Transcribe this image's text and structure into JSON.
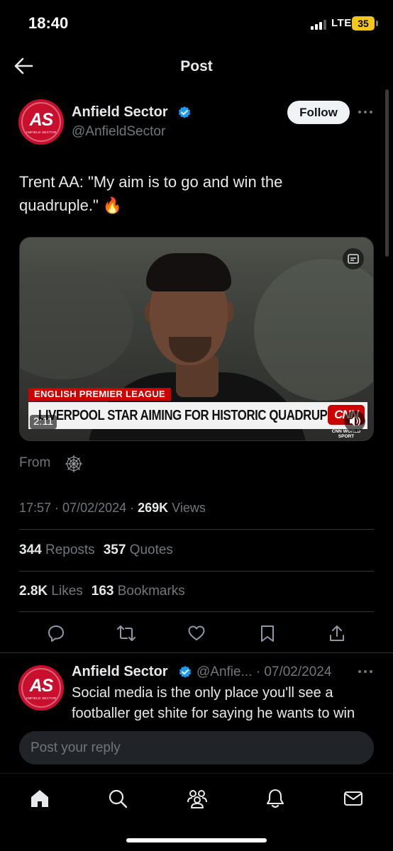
{
  "status_bar": {
    "time": "18:40",
    "network": "LTE",
    "battery": "35"
  },
  "header": {
    "title": "Post"
  },
  "post": {
    "avatar_text": "AS",
    "avatar_subtext": "ANFIELD SECTOR",
    "author_name": "Anfield Sector",
    "author_handle": "@AnfieldSector",
    "follow_label": "Follow",
    "text": "Trent AA: \"My aim is to go and win the quadruple.\" 🔥",
    "video": {
      "tag": "ENGLISH PREMIER LEAGUE",
      "headline": "LIVERPOOL STAR AIMING FOR HISTORIC QUADRUPLE",
      "logo": "CNN",
      "logo_sub": "CNN WORLD SPORT",
      "duration": "2:11"
    },
    "from_label": "From",
    "timestamp": "17:57 · 07/02/2024 · ",
    "views_count": "269K",
    "views_label": " Views",
    "reposts_count": "344",
    "reposts_label": " Reposts",
    "quotes_count": "357",
    "quotes_label": " Quotes",
    "likes_count": "2.8K",
    "likes_label": " Likes",
    "bookmarks_count": "163",
    "bookmarks_label": " Bookmarks"
  },
  "reply": {
    "author_name": "Anfield Sector",
    "meta": "@Anfie... · 07/02/2024",
    "text": "Social media is the only place you'll see a footballer get shite for saying he wants to win everything"
  },
  "compose": {
    "placeholder": "Post your reply"
  },
  "icons": {
    "actions": [
      "reply-icon",
      "repost-icon",
      "like-icon",
      "bookmark-icon",
      "share-icon"
    ],
    "tabs": [
      "home-icon",
      "search-icon",
      "communities-icon",
      "notifications-icon",
      "messages-icon"
    ]
  },
  "colors": {
    "verified": "#1d9bf0",
    "avatar_bg": "#c8102e",
    "cnn_red": "#cc0000",
    "battery": "#f5c518"
  }
}
